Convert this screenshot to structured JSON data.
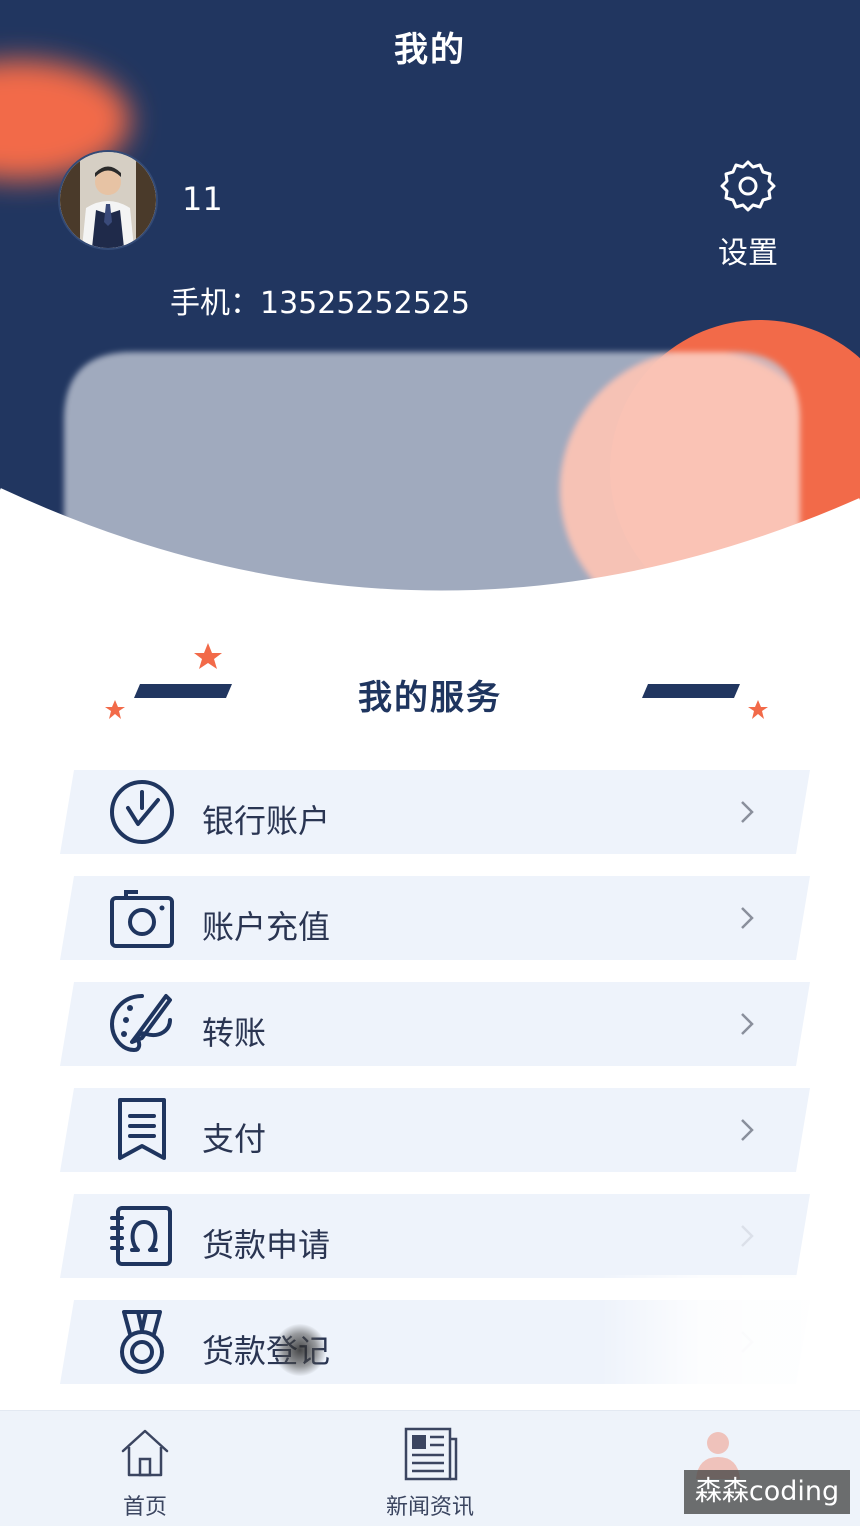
{
  "header": {
    "title": "我的",
    "username": "11",
    "phone": "手机：13525252525",
    "settings_label": "设置",
    "colors": {
      "navy": "#213660",
      "accent": "#f26a49"
    }
  },
  "services": {
    "title": "我的服务",
    "items": [
      {
        "label": "银行账户",
        "icon": "clock-check-icon"
      },
      {
        "label": "账户充值",
        "icon": "camera-icon"
      },
      {
        "label": "转账",
        "icon": "palette-brush-icon"
      },
      {
        "label": "支付",
        "icon": "bookmark-list-icon"
      },
      {
        "label": "货款申请",
        "icon": "omega-frame-icon"
      },
      {
        "label": "货款登记",
        "icon": "medal-icon"
      }
    ]
  },
  "tabbar": {
    "items": [
      {
        "label": "首页",
        "icon": "home-icon"
      },
      {
        "label": "新闻资讯",
        "icon": "newspaper-icon"
      },
      {
        "label": "",
        "icon": "user-icon"
      }
    ]
  },
  "watermark": "森森coding"
}
